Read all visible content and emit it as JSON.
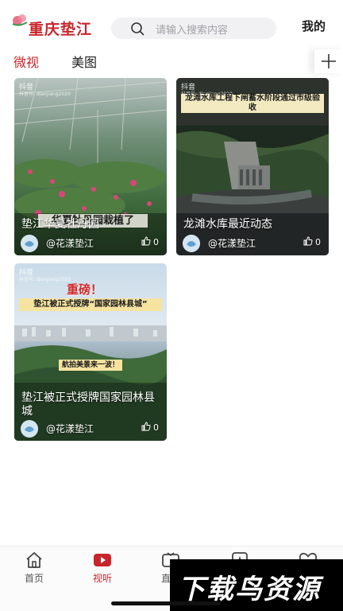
{
  "header": {
    "logo_text": "重庆垫江",
    "search_placeholder": "请输入搜索内容",
    "mine_label": "我的"
  },
  "tabs": [
    {
      "label": "微视",
      "active": true
    },
    {
      "label": "美图",
      "active": false
    }
  ],
  "cards": [
    {
      "title": "垫江华夏牡丹园",
      "author": "@花漾垫江",
      "likes": "0",
      "overlay": "华夏牡丹园栽植了",
      "source": "抖音",
      "source_id": "抖音号: dianjiang2020"
    },
    {
      "title": "龙滩水库最近动态",
      "author": "@花漾垫江",
      "likes": "0",
      "overlay": "龙滩水库工程下闸蓄水阶段通过市级验收",
      "source": "抖音",
      "source_id": "抖音号: dianjiang2020"
    },
    {
      "title": "垫江被正式授牌国家园林县城",
      "author": "@花漾垫江",
      "likes": "0",
      "overlay_1": "重磅！",
      "overlay_2": "垫江被正式授牌“国家园林县城”",
      "overlay_3": "航拍美景来一波！",
      "source": "抖音",
      "source_id": "抖音号: dianjiang2020"
    }
  ],
  "bottom_nav": [
    {
      "label": "首页",
      "icon": "home-icon",
      "active": false
    },
    {
      "label": "视听",
      "icon": "play-icon",
      "active": true
    },
    {
      "label": "直播",
      "icon": "live-icon",
      "active": false
    },
    {
      "label": "",
      "icon": "star-icon",
      "active": false
    },
    {
      "label": "",
      "icon": "heart-icon",
      "active": false
    }
  ],
  "watermark": "下载鸟资源",
  "colors": {
    "accent": "#c8252c",
    "search_bg": "#f1f1f3"
  }
}
